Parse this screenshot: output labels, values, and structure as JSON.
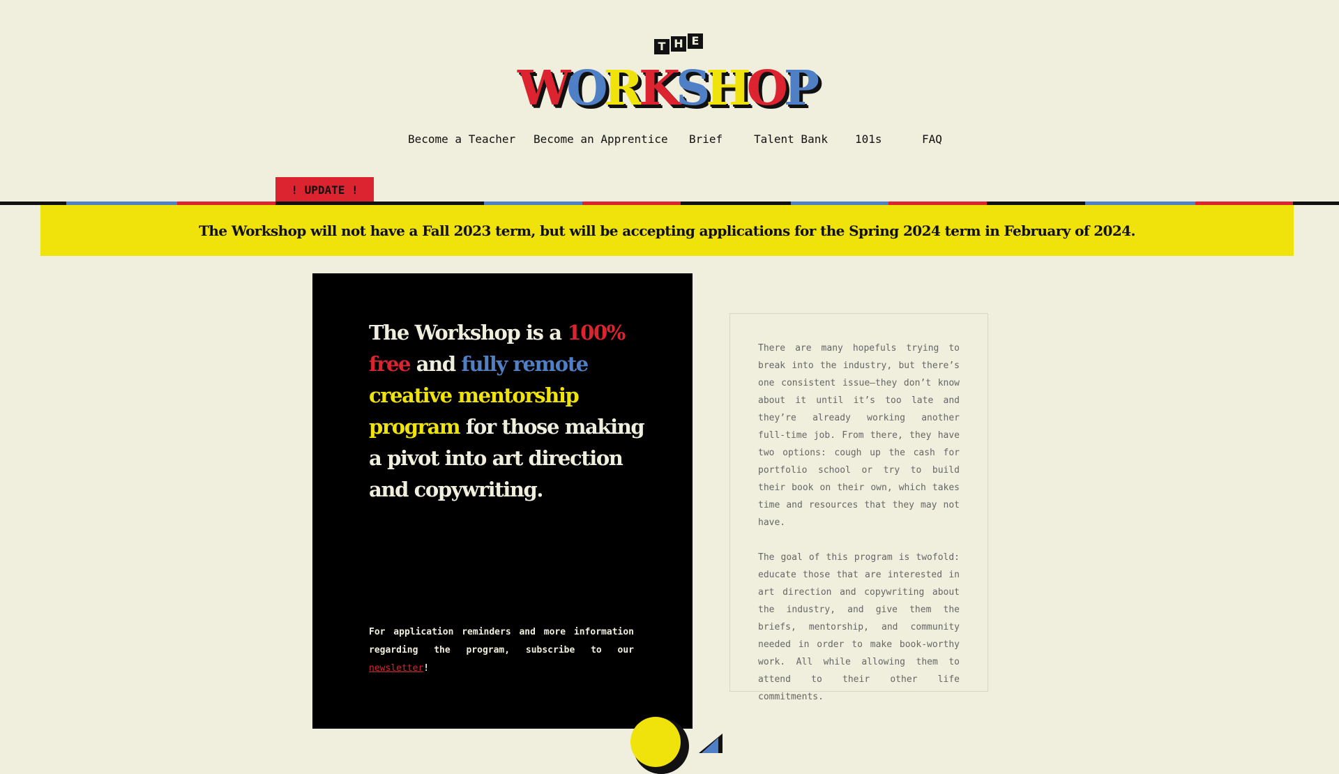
{
  "logo": {
    "the_letters": [
      "T",
      "H",
      "E"
    ],
    "word_letters": [
      {
        "ch": "W",
        "color": "#dc2430"
      },
      {
        "ch": "O",
        "color": "#4f7fc5"
      },
      {
        "ch": "R",
        "color": "#f0e20b"
      },
      {
        "ch": "K",
        "color": "#dc2430"
      },
      {
        "ch": "S",
        "color": "#4f7fc5"
      },
      {
        "ch": "H",
        "color": "#f0e20b"
      },
      {
        "ch": "O",
        "color": "#dc2430"
      },
      {
        "ch": "P",
        "color": "#4f7fc5"
      }
    ]
  },
  "nav": {
    "items": [
      "Become a Teacher",
      "Become an Apprentice",
      "Brief",
      "Talent Bank",
      "101s",
      "FAQ"
    ]
  },
  "update": {
    "tab_label": "! UPDATE !",
    "banner_text": "The Workshop will not have a Fall 2023 term, but will be accepting applications for the Spring 2024 term in February of 2024."
  },
  "stripe_colors": [
    "#111111",
    "#4f7fc5",
    "#dc2430",
    "#111111",
    "#4f7fc5",
    "#dc2430",
    "#111111",
    "#4f7fc5",
    "#dc2430",
    "#111111",
    "#4f7fc5",
    "#dc2430",
    "#111111",
    "#4f7fc5"
  ],
  "hero": {
    "line1": "The Workshop is a",
    "free": "100% free",
    "and": "and",
    "fully_remote": "fully remote",
    "creative_program": "creative mentorship program",
    "rest": "for those making a pivot into art direction and copywriting.",
    "note_prefix": "For application reminders and more information regarding the program, subscribe to our",
    "newsletter_link": "newsletter",
    "note_suffix": "!"
  },
  "description": {
    "para1": "There are many hopefuls trying to break into the industry, but there’s one consistent issue—they don’t know about it until it’s too late and they’re already working another full-time job. From there, they have two options: cough up the cash for portfolio school or try to build their book on their own, which takes time and resources that they may not have.",
    "para2": "The goal of this program is twofold: educate those that are interested in art direction and copywriting about the industry, and give them the briefs, mentorship, and community needed in order to make book-worthy work. All while allowing them to attend to their other life commitments."
  },
  "colors": {
    "background": "#f0eedc",
    "red": "#dc2430",
    "blue": "#4f7fc5",
    "yellow": "#f0e20b",
    "black": "#111111"
  }
}
